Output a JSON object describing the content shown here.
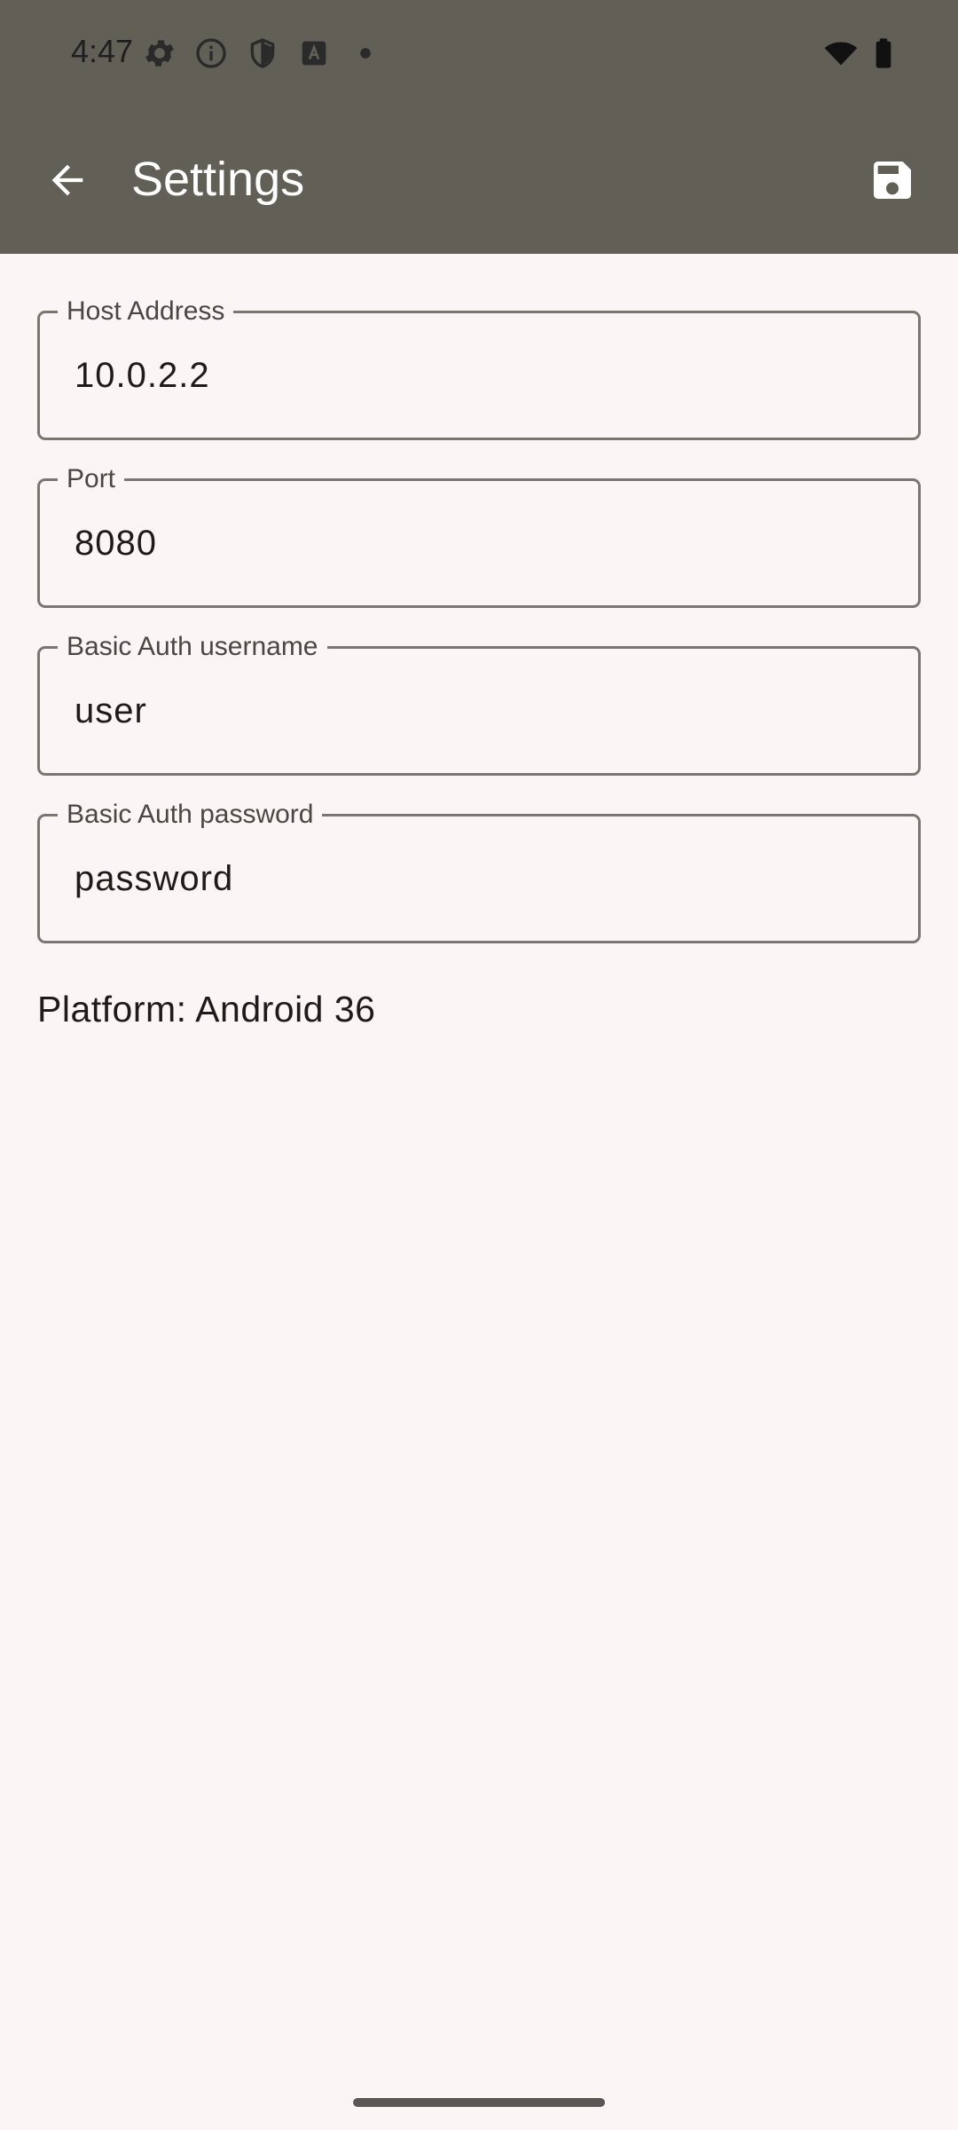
{
  "status_bar": {
    "time": "4:47",
    "left_icons": [
      "gear-icon",
      "info-icon",
      "shield-icon",
      "text-a-icon",
      "dot-icon"
    ],
    "right_icons": [
      "wifi-icon",
      "battery-icon"
    ]
  },
  "app_bar": {
    "title": "Settings",
    "back_icon": "arrow-back-icon",
    "save_icon": "save-icon",
    "background_color": "#625f56"
  },
  "fields": {
    "host": {
      "label": "Host Address",
      "value": "10.0.2.2"
    },
    "port": {
      "label": "Port",
      "value": "8080"
    },
    "username": {
      "label": "Basic Auth username",
      "value": "user"
    },
    "password": {
      "label": "Basic Auth password",
      "value": "password"
    }
  },
  "platform_text": "Platform: Android 36",
  "colors": {
    "background": "#fbf6f5",
    "outline": "#7a7670",
    "text": "#1e1b18"
  }
}
